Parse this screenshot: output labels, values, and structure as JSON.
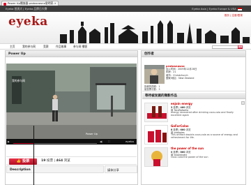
{
  "browser": {
    "tab_title": "Power Up播放器 protosnasno發明家…",
    "tab_close": "×"
  },
  "topbar": {
    "left": "Eyeka 首頁大 | Eyeka 品牌日大賽",
    "right": "Eyeka Asia | Eyeka Europe & USA"
  },
  "header": {
    "logo": "eyeka",
    "links": "首页 | 注册/登录"
  },
  "nav": {
    "items": [
      "主页",
      "我的参与网",
      "竞赛",
      "作品故事",
      "参与网 播客"
    ],
    "search_button": "搜索"
  },
  "video_panel": {
    "title": "Power Up",
    "video_title_overlay": "我的参与网",
    "video_time_left": "0:00",
    "video_label": "Power Up",
    "video_brand": "eyeka",
    "vote_button": "投票",
    "vote_count_num": "19",
    "vote_count_label": "投票",
    "view_count_num": "464",
    "view_count_label": "浏览",
    "description_label": "Description",
    "share_label": "媒体分享"
  },
  "creator_panel": {
    "title": "创作者",
    "name": "protosnasno",
    "joined": "加入时间：2009年12月28日",
    "age": "年龄：21",
    "city": "城市：Christchurch",
    "country": "国家/地区：New Zealand",
    "stat1": "投稿的视频：1",
    "stat2": "被投票次数：3"
  },
  "works_panel": {
    "title": "等待被发掘的微影作品",
    "items": [
      {
        "title": "enjoin energy",
        "votes": "3",
        "views": "460",
        "by": "TaraRafaella",
        "desc": "energy recovered after drinking coca-cola and finally excellent again"
      },
      {
        "title": "GoForColas",
        "votes": "8",
        "views": "660",
        "by": "protodex",
        "desc": "This artifact depicts coca-cola as a source of energy and refreshment for life."
      },
      {
        "title": "the power of the sun",
        "votes": "0",
        "views": "660",
        "by": "boonstudio",
        "desc": "Coca-Cola:the power of the sun"
      }
    ]
  },
  "colors": {
    "brand_red": "#c8102e",
    "topbar": "#3c3c3c"
  }
}
